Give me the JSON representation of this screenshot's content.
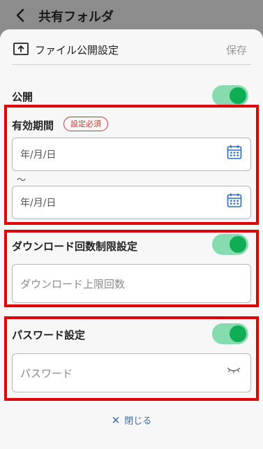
{
  "topbar": {
    "title": "共有フォルダ"
  },
  "sheet": {
    "title": "ファイル公開設定",
    "save_label": "保存"
  },
  "public": {
    "label": "公開",
    "enabled": true
  },
  "validity": {
    "label": "有効期間",
    "required_badge": "設定必須",
    "start_placeholder": "年/月/日",
    "separator": "～",
    "end_placeholder": "年/月/日"
  },
  "download_limit": {
    "label": "ダウンロード回数制限設定",
    "enabled": true,
    "placeholder": "ダウンロード上限回数"
  },
  "password": {
    "label": "パスワード設定",
    "enabled": true,
    "placeholder": "パスワード"
  },
  "footer": {
    "close_label": "閉じる"
  },
  "colors": {
    "toggle_on": "#0fae54",
    "toggle_track": "#86dcae",
    "highlight": "#e00000",
    "link": "#3d6fb0"
  },
  "icons": [
    "back-arrow-icon",
    "upload-icon",
    "calendar-icon",
    "eye-closed-icon",
    "close-icon"
  ]
}
